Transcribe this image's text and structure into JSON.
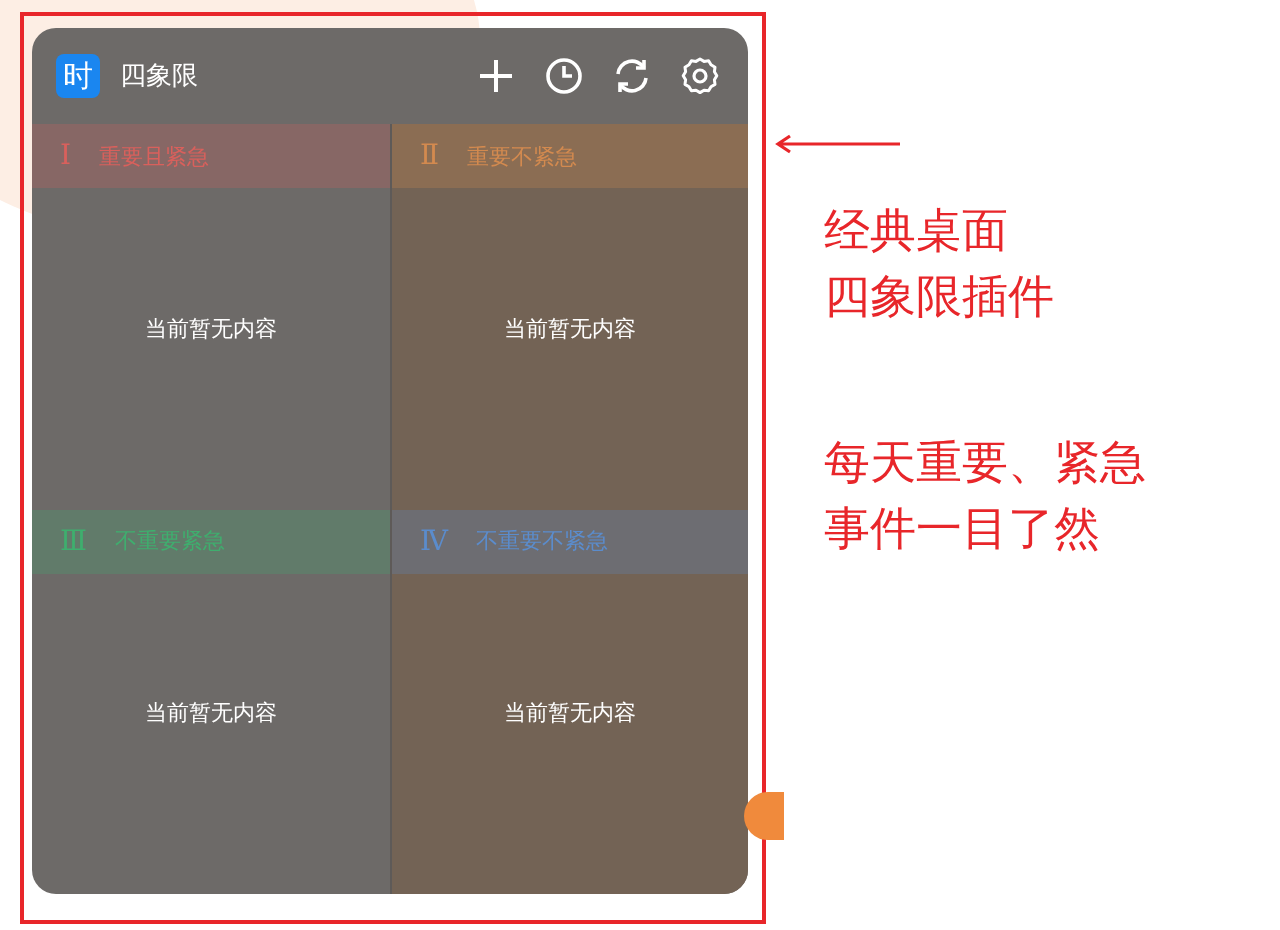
{
  "widget": {
    "app_icon_text": "时",
    "title": "四象限",
    "quadrants": [
      {
        "numeral": "Ⅰ",
        "label": "重要且紧急",
        "empty_text": "当前暂无内容",
        "color": "#d9605c"
      },
      {
        "numeral": "Ⅱ",
        "label": "重要不紧急",
        "empty_text": "当前暂无内容",
        "color": "#d38a4f"
      },
      {
        "numeral": "Ⅲ",
        "label": "不重要紧急",
        "empty_text": "当前暂无内容",
        "color": "#3fae6e"
      },
      {
        "numeral": "Ⅳ",
        "label": "不重要不紧急",
        "empty_text": "当前暂无内容",
        "color": "#5b8ccc"
      }
    ]
  },
  "annotations": [
    {
      "lines": [
        "经典桌面",
        "四象限插件"
      ]
    },
    {
      "lines": [
        "每天重要、紧急",
        "事件一目了然"
      ]
    }
  ]
}
